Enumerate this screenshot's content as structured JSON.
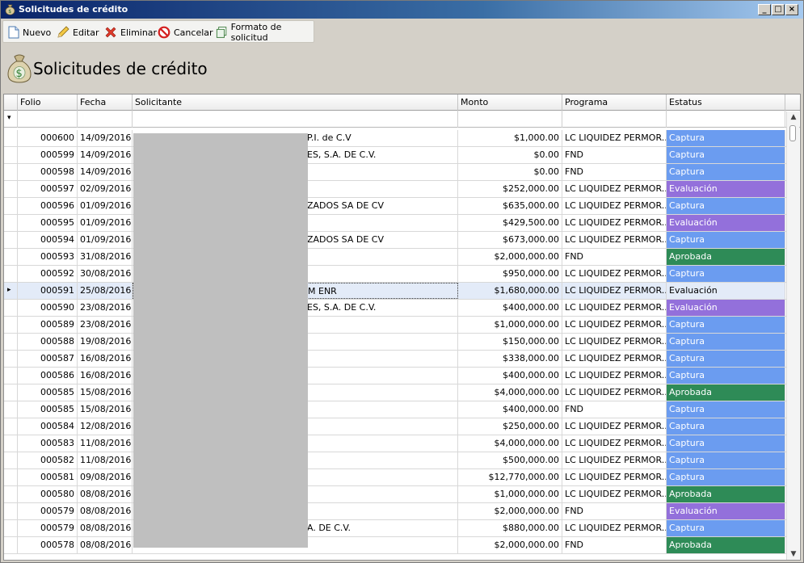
{
  "window": {
    "title": "Solicitudes de crédito",
    "min": "_",
    "max": "□",
    "close": "×"
  },
  "toolbar": {
    "nuevo": "Nuevo",
    "editar": "Editar",
    "eliminar": "Eliminar",
    "cancelar": "Cancelar",
    "formato": "Formato de solicitud"
  },
  "page": {
    "title": "Solicitudes de crédito"
  },
  "columns": {
    "folio": "Folio",
    "fecha": "Fecha",
    "solicitante": "Solicitante",
    "monto": "Monto",
    "programa": "Programa",
    "estatus": "Estatus"
  },
  "filter_icon": "▾",
  "colors": {
    "captura": "#6b9cf0",
    "evaluacion": "#9370db",
    "aprobada": "#2e8b57",
    "selected_row": "#e3ebf8"
  },
  "rows": [
    {
      "folio": "000600",
      "fecha": "14/09/2016",
      "solicitante": "P.I. de C.V",
      "monto": "$1,000.00",
      "programa": "LC LIQUIDEZ PERMOR...",
      "estatus": "Captura",
      "color": "#6b9cf0"
    },
    {
      "folio": "000599",
      "fecha": "14/09/2016",
      "solicitante": "ES, S.A. DE C.V.",
      "monto": "$0.00",
      "programa": "FND",
      "estatus": "Captura",
      "color": "#6b9cf0"
    },
    {
      "folio": "000598",
      "fecha": "14/09/2016",
      "solicitante": "",
      "monto": "$0.00",
      "programa": "FND",
      "estatus": "Captura",
      "color": "#6b9cf0"
    },
    {
      "folio": "000597",
      "fecha": "02/09/2016",
      "solicitante": "",
      "monto": "$252,000.00",
      "programa": "LC LIQUIDEZ PERMOR...",
      "estatus": "Evaluación",
      "color": "#9370db"
    },
    {
      "folio": "000596",
      "fecha": "01/09/2016",
      "solicitante": "ZADOS SA DE CV",
      "monto": "$635,000.00",
      "programa": "LC LIQUIDEZ PERMOR...",
      "estatus": "Captura",
      "color": "#6b9cf0"
    },
    {
      "folio": "000595",
      "fecha": "01/09/2016",
      "solicitante": "",
      "monto": "$429,500.00",
      "programa": "LC LIQUIDEZ PERMOR...",
      "estatus": "Evaluación",
      "color": "#9370db"
    },
    {
      "folio": "000594",
      "fecha": "01/09/2016",
      "solicitante": "ZADOS SA DE CV",
      "monto": "$673,000.00",
      "programa": "LC LIQUIDEZ PERMOR...",
      "estatus": "Captura",
      "color": "#6b9cf0"
    },
    {
      "folio": "000593",
      "fecha": "31/08/2016",
      "solicitante": "",
      "monto": "$2,000,000.00",
      "programa": "FND",
      "estatus": "Aprobada",
      "color": "#2e8b57"
    },
    {
      "folio": "000592",
      "fecha": "30/08/2016",
      "solicitante": "",
      "monto": "$950,000.00",
      "programa": "LC LIQUIDEZ PERMOR...",
      "estatus": "Captura",
      "color": "#6b9cf0"
    },
    {
      "folio": "000591",
      "fecha": "25/08/2016",
      "solicitante": "M ENR",
      "monto": "$1,680,000.00",
      "programa": "LC LIQUIDEZ PERMOR...",
      "estatus": "Evaluación",
      "color": "",
      "selected": true
    },
    {
      "folio": "000590",
      "fecha": "23/08/2016",
      "solicitante": "ES, S.A. DE C.V.",
      "monto": "$400,000.00",
      "programa": "LC LIQUIDEZ PERMOR...",
      "estatus": "Evaluación",
      "color": "#9370db"
    },
    {
      "folio": "000589",
      "fecha": "23/08/2016",
      "solicitante": "",
      "monto": "$1,000,000.00",
      "programa": "LC LIQUIDEZ PERMOR...",
      "estatus": "Captura",
      "color": "#6b9cf0"
    },
    {
      "folio": "000588",
      "fecha": "19/08/2016",
      "solicitante": "",
      "monto": "$150,000.00",
      "programa": "LC LIQUIDEZ PERMOR...",
      "estatus": "Captura",
      "color": "#6b9cf0"
    },
    {
      "folio": "000587",
      "fecha": "16/08/2016",
      "solicitante": "",
      "monto": "$338,000.00",
      "programa": "LC LIQUIDEZ PERMOR...",
      "estatus": "Captura",
      "color": "#6b9cf0"
    },
    {
      "folio": "000586",
      "fecha": "16/08/2016",
      "solicitante": "",
      "monto": "$400,000.00",
      "programa": "LC LIQUIDEZ PERMOR...",
      "estatus": "Captura",
      "color": "#6b9cf0"
    },
    {
      "folio": "000585",
      "fecha": "15/08/2016",
      "solicitante": "",
      "monto": "$4,000,000.00",
      "programa": "LC LIQUIDEZ PERMOR...",
      "estatus": "Aprobada",
      "color": "#2e8b57"
    },
    {
      "folio": "000585",
      "fecha": "15/08/2016",
      "solicitante": "",
      "monto": "$400,000.00",
      "programa": "FND",
      "estatus": "Captura",
      "color": "#6b9cf0"
    },
    {
      "folio": "000584",
      "fecha": "12/08/2016",
      "solicitante": "",
      "monto": "$250,000.00",
      "programa": "LC LIQUIDEZ PERMOR...",
      "estatus": "Captura",
      "color": "#6b9cf0"
    },
    {
      "folio": "000583",
      "fecha": "11/08/2016",
      "solicitante": "",
      "monto": "$4,000,000.00",
      "programa": "LC LIQUIDEZ PERMOR...",
      "estatus": "Captura",
      "color": "#6b9cf0"
    },
    {
      "folio": "000582",
      "fecha": "11/08/2016",
      "solicitante": "",
      "monto": "$500,000.00",
      "programa": "LC LIQUIDEZ PERMOR...",
      "estatus": "Captura",
      "color": "#6b9cf0"
    },
    {
      "folio": "000581",
      "fecha": "09/08/2016",
      "solicitante": "",
      "monto": "$12,770,000.00",
      "programa": "LC LIQUIDEZ PERMOR...",
      "estatus": "Captura",
      "color": "#6b9cf0"
    },
    {
      "folio": "000580",
      "fecha": "08/08/2016",
      "solicitante": "",
      "monto": "$1,000,000.00",
      "programa": "LC LIQUIDEZ PERMOR...",
      "estatus": "Aprobada",
      "color": "#2e8b57"
    },
    {
      "folio": "000579",
      "fecha": "08/08/2016",
      "solicitante": "",
      "monto": "$2,000,000.00",
      "programa": "FND",
      "estatus": "Evaluación",
      "color": "#9370db"
    },
    {
      "folio": "000579",
      "fecha": "08/08/2016",
      "solicitante": "A. DE C.V.",
      "monto": "$880,000.00",
      "programa": "LC LIQUIDEZ PERMOR...",
      "estatus": "Captura",
      "color": "#6b9cf0"
    },
    {
      "folio": "000578",
      "fecha": "08/08/2016",
      "solicitante": "",
      "monto": "$2,000,000.00",
      "programa": "FND",
      "estatus": "Aprobada",
      "color": "#2e8b57"
    }
  ]
}
